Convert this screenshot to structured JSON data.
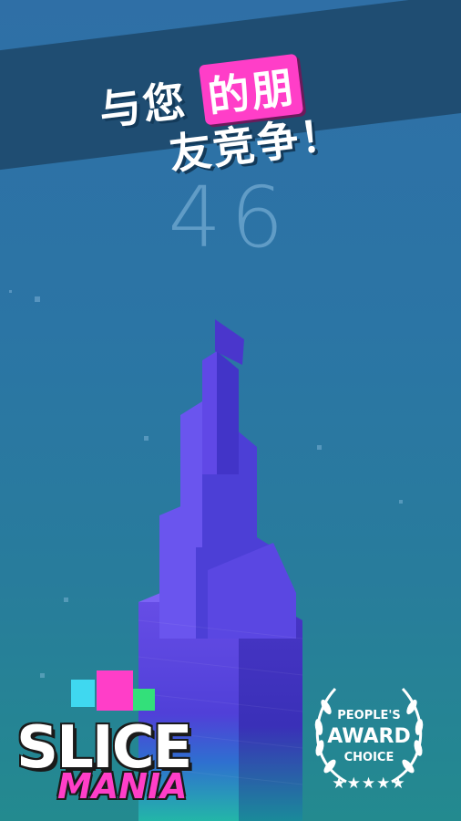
{
  "slogan": {
    "line1_plain": "与您",
    "line1_highlight": "的朋",
    "line2": "友竞争！"
  },
  "score": "46",
  "logo": {
    "word1": "SLICE",
    "word2": "MANIA"
  },
  "award": {
    "line1": "PEOPLE'S",
    "line2": "AWARD",
    "line3": "CHOICE",
    "stars": "★★★★★"
  },
  "colors": {
    "highlight": "#ff3ec8",
    "banner": "#1f4d72",
    "tower_top": "#6a4fe8",
    "tower_bottom": "#23b6a8"
  }
}
